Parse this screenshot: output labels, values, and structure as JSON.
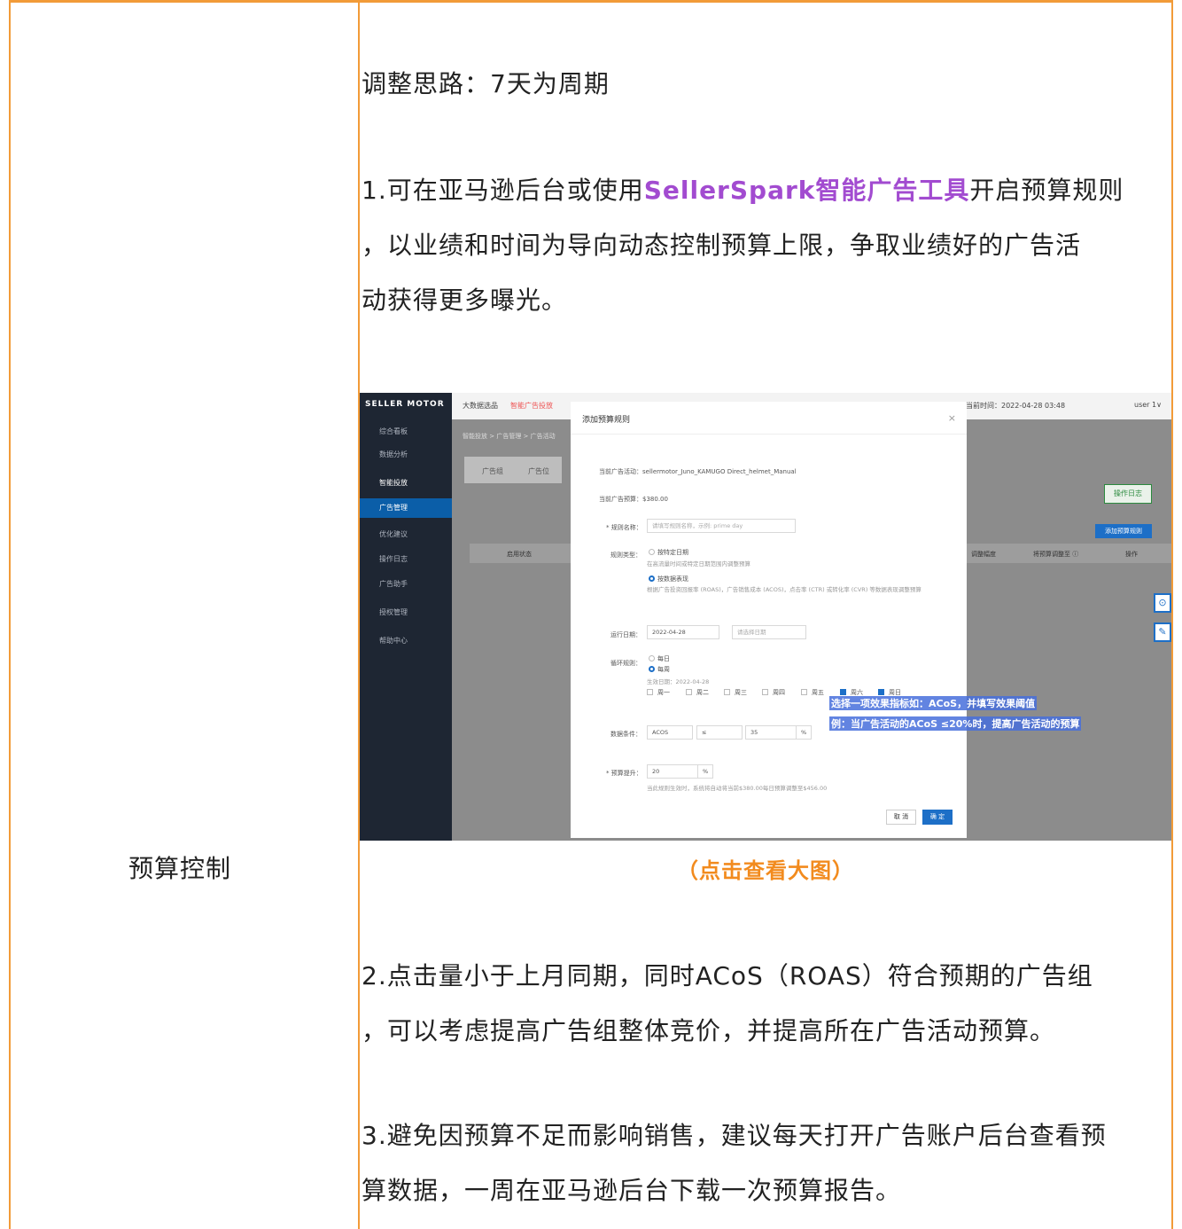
{
  "left_label": "预算控制",
  "p0": "调整思路：7天为周期",
  "p1": {
    "before": "1.可在亚马逊后台或使用",
    "highlight": "SellerSpark智能广告工具",
    "after_line1": "开启预算规则",
    "line2": "，以业绩和时间为导向动态控制预算上限，争取业绩好的广告活",
    "line3": "动获得更多曝光。"
  },
  "screenshot": {
    "logo": "SELLER MOTOR",
    "top_nav": [
      "大数据选品",
      "智能广告投放"
    ],
    "top_right_time": "当前时间：2022-04-28 03:48",
    "top_right_user": "user 1∨",
    "side_menu": [
      "综合看板",
      "数据分析",
      "智能投放",
      "广告管理",
      "优化建议",
      "操作日志",
      "广告助手",
      "授权管理",
      "帮助中心"
    ],
    "crumb": "智能投放 > 广告管理 > 广告活动",
    "tabs": [
      "广告组",
      "广告位"
    ],
    "op_log_btn": "操作日志",
    "add_rule_btn": "添加预算规则",
    "table_headers": [
      "启用状态",
      "调整幅度",
      "将预算调整至 ⓘ",
      "操作"
    ],
    "modal": {
      "title": "添加预算规则",
      "close": "×",
      "campaign_label": "当前广告活动：",
      "campaign_value": "sellermotor_Juno_KAMUGO Direct_helmet_Manual",
      "budget_label": "当前广告预算：",
      "budget_value": "$380.00",
      "rule_name_label": "* 规则名称：",
      "rule_name_placeholder": "请填写规则名称，示例: prime day",
      "rule_type_label": "规则类型：",
      "opt1": "按特定日期",
      "opt1_desc": "在高流量时间或特定日期范围内调整预算",
      "opt2": "按数据表现",
      "opt2_desc": "根据广告投资回报率 (ROAS)，广告销售成本 (ACOS)，点击率 (CTR) 或转化率 (CVR) 等数据表现调整预算",
      "run_date_label": "运行日期：",
      "run_date_value": "2022-04-28",
      "run_date_end": "请选择日期",
      "cycle_label": "循环规则：",
      "cycle_daily": "每日",
      "cycle_weekly": "每周",
      "effective_date": "生效日期：2022-04-28",
      "weekdays": [
        "周一",
        "周二",
        "周三",
        "周四",
        "周五",
        "周六",
        "周日"
      ],
      "cond_label": "数据条件：",
      "cond_metric": "ACOS",
      "cond_op": "≤",
      "cond_value": "35",
      "cond_unit": "%",
      "raise_label": "* 预算提升：",
      "raise_value": "20",
      "raise_unit": "%",
      "raise_note": "当此规则生效时，系统将自动将当前$380.00每日预算调整至$456.00",
      "cancel": "取 消",
      "ok": "确 定"
    },
    "annotation1": "选择一项效果指标如：ACoS，并填写效果阈值",
    "annotation2": "例：当广告活动的ACoS ≤20%时，提高广告活动的预算"
  },
  "caption": "（点击查看大图）",
  "p2": {
    "line1": "2.点击量小于上月同期，同时ACoS（ROAS）符合预期的广告组",
    "line2": "，可以考虑提高广告组整体竞价，并提高所在广告活动预算。"
  },
  "p3": {
    "line1": "3.避免因预算不足而影响销售，建议每天打开广告账户后台查看预",
    "line2": "算数据，一周在亚马逊后台下载一次预算报告。"
  },
  "colors": {
    "border": "#f29b38",
    "highlight": "#a24bd0",
    "caption": "#f28b1e"
  }
}
